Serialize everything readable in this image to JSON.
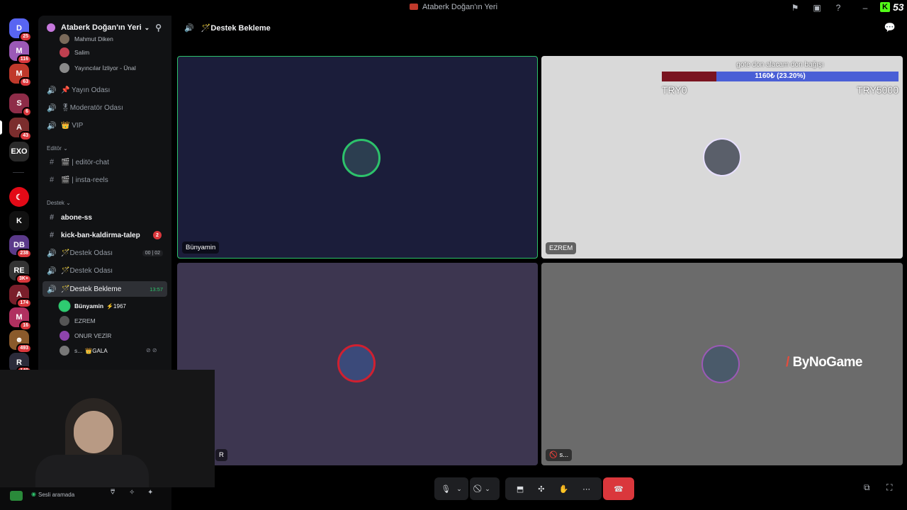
{
  "window": {
    "title": "Ataberk Doğan'ın Yeri"
  },
  "guilds": [
    {
      "name": "discord-home",
      "badge": "25",
      "color": "#5865f2",
      "label": "D"
    },
    {
      "name": "guild-m",
      "badge": "116",
      "color": "#9b59b6",
      "label": "M"
    },
    {
      "name": "guild-m2",
      "badge": "63",
      "color": "#c0392b",
      "label": "M"
    },
    {
      "name": "guild-s",
      "badge": "6",
      "color": "#8e2c48",
      "label": "S"
    },
    {
      "name": "guild-a",
      "badge": "43",
      "color": "#7b2d2d",
      "label": "A"
    },
    {
      "name": "guild-exo",
      "badge": "",
      "color": "#2a2a2a",
      "label": "EXO"
    },
    {
      "name": "guild-tr",
      "badge": "",
      "color": "#e30a17",
      "label": "☾"
    },
    {
      "name": "guild-kick",
      "badge": "",
      "color": "#111",
      "label": "K"
    },
    {
      "name": "guild-dobby",
      "badge": "238",
      "color": "#5b3a8a",
      "label": "DB"
    },
    {
      "name": "guild-react",
      "badge": "3K+",
      "color": "#333",
      "label": "RE"
    },
    {
      "name": "guild-a2",
      "badge": "174",
      "color": "#7a1f2b",
      "label": "A"
    },
    {
      "name": "guild-m3",
      "badge": "16",
      "color": "#b03060",
      "label": "M"
    },
    {
      "name": "guild-char",
      "badge": "493",
      "color": "#8a5a2b",
      "label": "☻"
    },
    {
      "name": "guild-robo",
      "badge": "140",
      "color": "#2b2b3a",
      "label": "R"
    }
  ],
  "sidebar": {
    "server_name": "Ataberk Doğan'ın Yeri",
    "top_members": [
      {
        "name": "Mahmut Diken",
        "color": "#7a6a5a"
      },
      {
        "name": "Salim",
        "color": "#c04050"
      },
      {
        "name": "Yayıncılar İzliyor - Ünal",
        "color": "#8a8a8a"
      }
    ],
    "channels_a": [
      {
        "label": "📌 Yayın Odası",
        "icon": "🔊"
      },
      {
        "label": "🎖Moderatör Odası",
        "icon": "🔊"
      },
      {
        "label": "👑 VIP",
        "icon": "🔊"
      }
    ],
    "cat_editor": "Editör",
    "channels_editor": [
      {
        "label": "🎬 | editör-chat",
        "icon": "#"
      },
      {
        "label": "🎬 | insta-reels",
        "icon": "#"
      }
    ],
    "cat_support": "Destek",
    "channels_support": [
      {
        "label": "abone-ss",
        "icon": "#"
      },
      {
        "label": "kick-ban-kaldirma-talep",
        "icon": "#",
        "badge": "2"
      },
      {
        "label": "🪄Destek Odası",
        "icon": "🔊",
        "users": "00",
        "limit": "02"
      },
      {
        "label": "🪄Destek Odası",
        "icon": "🔊"
      },
      {
        "label": "🪄Destek Bekleme",
        "icon": "🔊",
        "timer": "13:57"
      }
    ],
    "voice_members": [
      {
        "name": "Bünyamin",
        "extra": "⚡1967",
        "color": "#2ecc71"
      },
      {
        "name": "EZREM",
        "extra": "",
        "color": "#555"
      },
      {
        "name": "ONUR VEZİR",
        "extra": "",
        "color": "#8e44ad"
      },
      {
        "name": "s...",
        "extra": "👑GALA",
        "color": "#777"
      }
    ]
  },
  "header": {
    "channel_title": "🪄Destek Bekleme"
  },
  "tiles": [
    {
      "name": "Bünyamin",
      "bg": "#1b1d3a",
      "border": "#2dc26b"
    },
    {
      "name": "EZREM",
      "bg": "#d9d9d9",
      "border": "none"
    },
    {
      "name": "R",
      "bg": "#3d3650",
      "border": "none"
    },
    {
      "name": "s...",
      "bg": "#6b6b6b",
      "border": "none"
    }
  ],
  "donation": {
    "title": "gote don alacam don bağışı",
    "progress_text": "1160₺ (23.20%)",
    "progress": 0.232,
    "min_label": "TRY0",
    "max_label": "TRY5000"
  },
  "brand_logo": "ByNoGame",
  "user_panel": {
    "status": "Sesli aramada"
  }
}
